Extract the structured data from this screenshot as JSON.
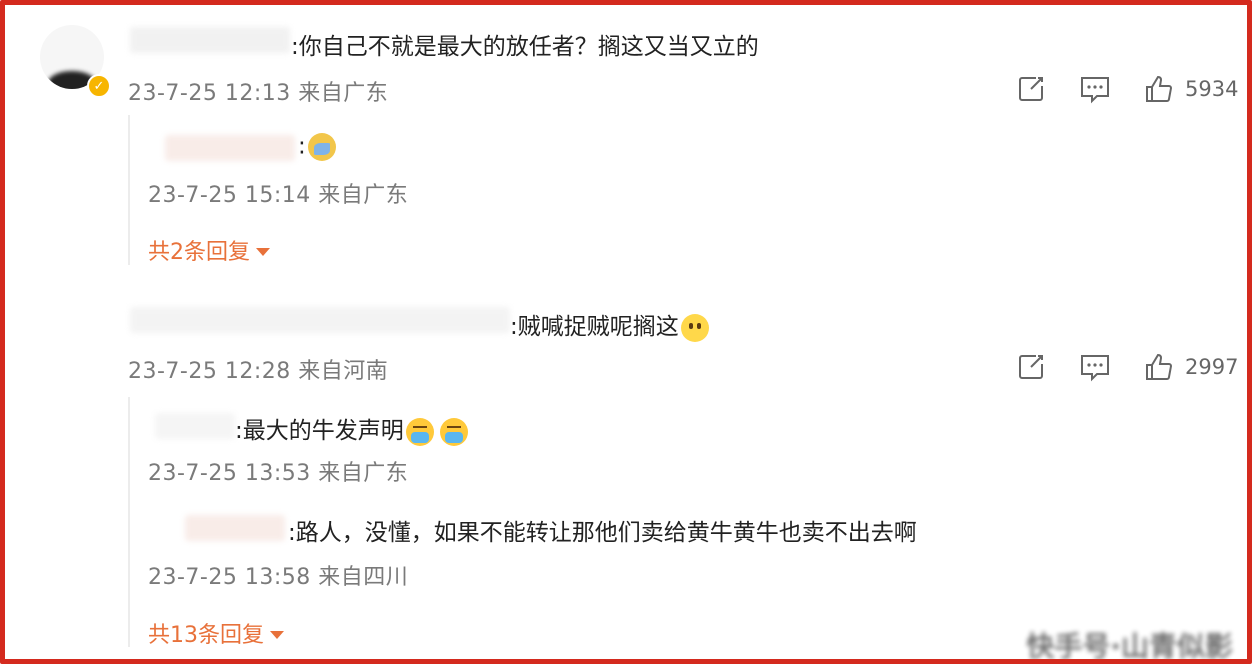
{
  "comments": [
    {
      "text": ":你自己不就是最大的放任者？搁这又当又立的",
      "meta": "23-7-25 12:13 来自广东",
      "likes": "5934",
      "replies": [
        {
          "text": ":",
          "meta": "23-7-25 15:14 来自广东"
        }
      ],
      "more_replies": "共2条回复"
    },
    {
      "text": ":贼喊捉贼呢搁这",
      "meta": "23-7-25 12:28 来自河南",
      "likes": "2997",
      "replies": [
        {
          "text": ":最大的牛发声明",
          "meta": "23-7-25 13:53 来自广东"
        },
        {
          "text": ":路人，没懂，如果不能转让那他们卖给黄牛黄牛也卖不出去啊",
          "meta": "23-7-25 13:58 来自四川"
        }
      ],
      "more_replies": "共13条回复"
    }
  ],
  "icons": {
    "share": "share-icon",
    "comment": "comment-icon",
    "like": "thumb-up-icon",
    "verified": "verified-badge-icon"
  },
  "colors": {
    "frame": "#d42a1e",
    "accent": "#e8713a",
    "meta": "#7a7a7a"
  }
}
